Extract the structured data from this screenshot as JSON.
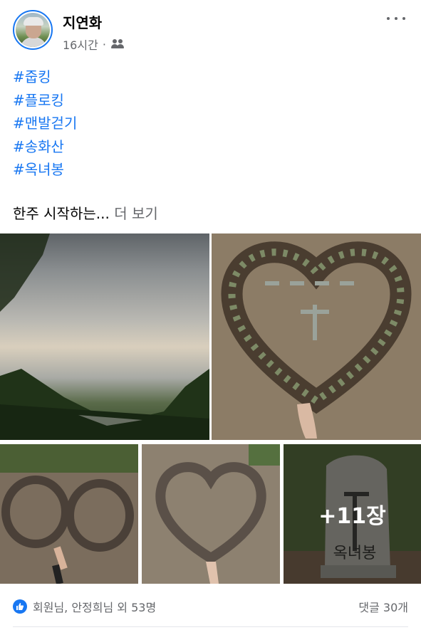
{
  "post": {
    "author": "지연화",
    "time": "16시간",
    "separator": "·",
    "audience_icon": "friends-icon",
    "hashtags": [
      "#줍킹",
      "#플로킹",
      "#맨발걷기",
      "#송화산",
      "#옥녀봉"
    ],
    "text": "한주 시작하는...",
    "see_more": "더 보기",
    "photos_more": "+11장",
    "photo_5_caption": "옥녀봉",
    "reactions": "회원님, 안정희님 외 53명",
    "comments": "댓글 30개"
  },
  "colors": {
    "link": "#1877f2",
    "secondary_text": "#65676b",
    "primary_text": "#050505"
  }
}
